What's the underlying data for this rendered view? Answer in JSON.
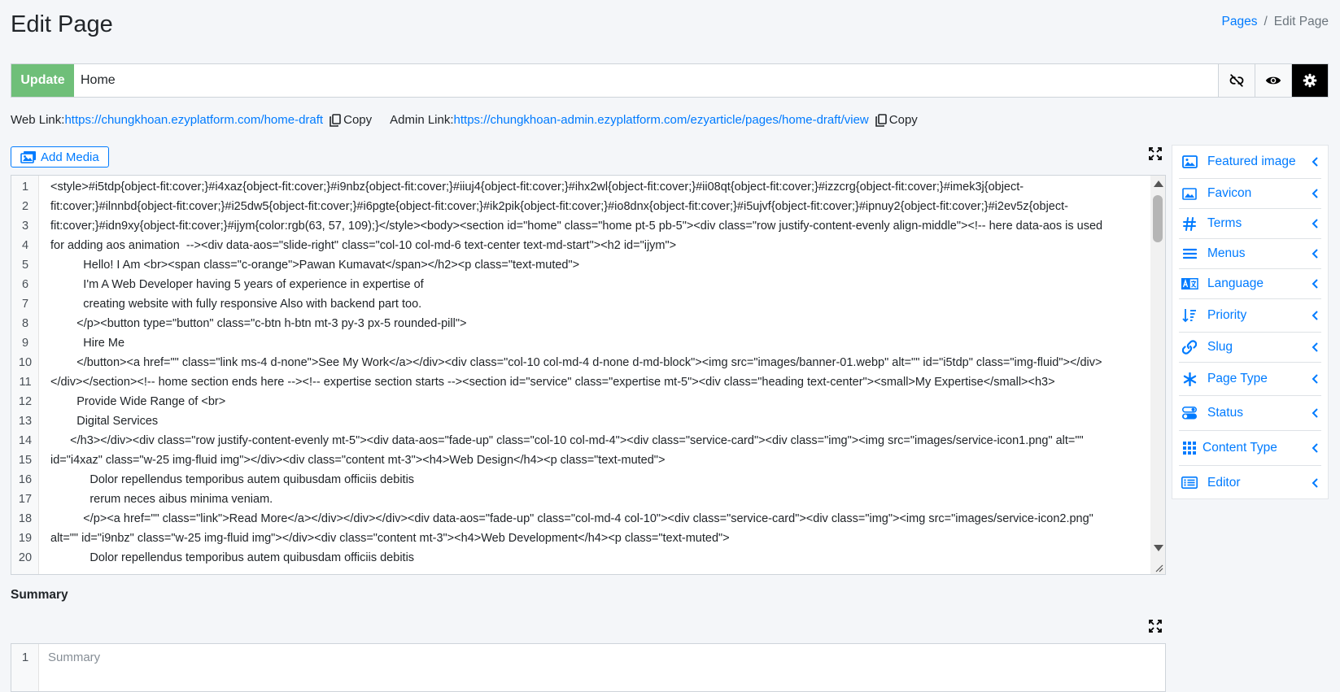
{
  "header": {
    "title": "Edit Page",
    "breadcrumb": [
      "Pages",
      "/",
      "Edit Page"
    ]
  },
  "titlebar": {
    "update_label": "Update",
    "title_value": "Home",
    "icons": [
      "unlink-icon",
      "eye-icon",
      "gear-icon"
    ]
  },
  "links": {
    "web_label": "Web Link:",
    "web_url": "https://chungkhoan.ezyplatform.com/home-draft",
    "admin_label": "Admin Link:",
    "admin_url": "https://chungkhoan-admin.ezyplatform.com/ezyarticle/pages/home-draft/view",
    "copy_label": "Copy"
  },
  "toolbar": {
    "add_media_label": "Add Media"
  },
  "editor": {
    "lines": [
      {
        "n": "1",
        "text": "<style>#i5tdp{object-fit:cover;}#i4xaz{object-fit:cover;}#i9nbz{object-fit:cover;}#iiuj4{object-fit:cover;}#ihx2wl{object-fit:cover;}#ii08qt{object-fit:cover;}#izzcrg{object-fit:cover;}#imek3j{object-"
      },
      {
        "n": "2",
        "text": "fit:cover;}#ilnnbd{object-fit:cover;}#i25dw5{object-fit:cover;}#i6pgte{object-fit:cover;}#ik2pik{object-fit:cover;}#io8dnx{object-fit:cover;}#i5ujvf{object-fit:cover;}#ipnuy2{object-fit:cover;}#i2ev5z{object-"
      },
      {
        "n": "3",
        "text": "fit:cover;}#idn9xy{object-fit:cover;}#ijym{color:rgb(63, 57, 109);}</style><body><section id=\"home\" class=\"home pt-5 pb-5\"><div class=\"row justify-content-evenly align-middle\"><!-- here data-aos is used"
      },
      {
        "n": "4",
        "text": "for adding aos animation  --><div data-aos=\"slide-right\" class=\"col-10 col-md-6 text-center text-md-start\"><h2 id=\"ijym\">"
      },
      {
        "n": "5",
        "text": "          Hello! I Am <br><span class=\"c-orange\">Pawan Kumavat</span></h2><p class=\"text-muted\">"
      },
      {
        "n": "6",
        "text": "          I'm A Web Developer having 5 years of experience in expertise of"
      },
      {
        "n": "7",
        "text": "          creating website with fully responsive Also with backend part too."
      },
      {
        "n": "8",
        "text": "        </p><button type=\"button\" class=\"c-btn h-btn mt-3 py-3 px-5 rounded-pill\">"
      },
      {
        "n": "9",
        "text": "          Hire Me"
      },
      {
        "n": "10",
        "text": "        </button><a href=\"\" class=\"link ms-4 d-none\">See My Work</a></div><div class=\"col-10 col-md-4 d-none d-md-block\"><img src=\"images/banner-01.webp\" alt=\"\" id=\"i5tdp\" class=\"img-fluid\"></div>"
      },
      {
        "n": "11",
        "text": "</div></section><!-- home section ends here --><!-- expertise section starts --><section id=\"service\" class=\"expertise mt-5\"><div class=\"heading text-center\"><small>My Expertise</small><h3>"
      },
      {
        "n": "12",
        "text": "        Provide Wide Range of <br>"
      },
      {
        "n": "13",
        "text": "        Digital Services"
      },
      {
        "n": "14",
        "text": "      </h3></div><div class=\"row justify-content-evenly mt-5\"><div data-aos=\"fade-up\" class=\"col-10 col-md-4\"><div class=\"service-card\"><div class=\"img\"><img src=\"images/service-icon1.png\" alt=\"\""
      },
      {
        "n": "15",
        "text": "id=\"i4xaz\" class=\"w-25 img-fluid img\"></div><div class=\"content mt-3\"><h4>Web Design</h4><p class=\"text-muted\">"
      },
      {
        "n": "16",
        "text": "            Dolor repellendus temporibus autem quibusdam officiis debitis"
      },
      {
        "n": "17",
        "text": "            rerum neces aibus minima veniam."
      },
      {
        "n": "18",
        "text": "          </p><a href=\"\" class=\"link\">Read More</a></div></div></div><div data-aos=\"fade-up\" class=\"col-md-4 col-10\"><div class=\"service-card\"><div class=\"img\"><img src=\"images/service-icon2.png\""
      },
      {
        "n": "19",
        "text": "alt=\"\" id=\"i9nbz\" class=\"w-25 img-fluid img\"></div><div class=\"content mt-3\"><h4>Web Development</h4><p class=\"text-muted\">"
      },
      {
        "n": "20",
        "text": "            Dolor repellendus temporibus autem quibusdam officiis debitis"
      }
    ]
  },
  "summary": {
    "label": "Summary",
    "line_number": "1",
    "placeholder": "Summary"
  },
  "sidebar": {
    "items": [
      {
        "label": "Featured image",
        "icon": "image-icon"
      },
      {
        "label": "Favicon",
        "icon": "picture-icon"
      },
      {
        "label": "Terms",
        "icon": "hashtag-icon"
      },
      {
        "label": "Menus",
        "icon": "bars-icon"
      },
      {
        "label": "Language",
        "icon": "language-icon"
      },
      {
        "label": "Priority",
        "icon": "sort-numeric-icon"
      },
      {
        "label": "Slug",
        "icon": "link-icon"
      },
      {
        "label": "Page Type",
        "icon": "asterisk-icon"
      },
      {
        "label": "Status",
        "icon": "toggle-icon"
      },
      {
        "label": "Content Type",
        "icon": "grid-icon"
      },
      {
        "label": "Editor",
        "icon": "list-alt-icon"
      }
    ]
  },
  "colors": {
    "link": "#007bff",
    "update_button": "#6fbf79",
    "background": "#f4f6f9"
  }
}
